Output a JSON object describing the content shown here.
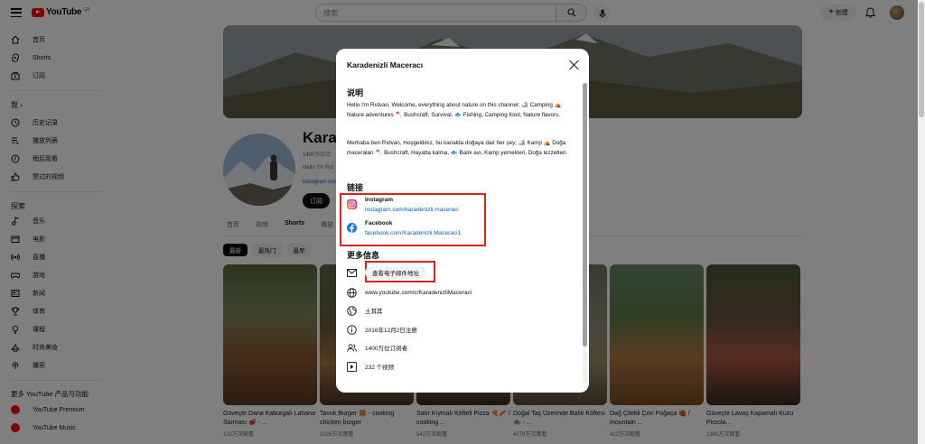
{
  "header": {
    "logo_text": "YouTube",
    "country": "GB",
    "search_placeholder": "搜索",
    "create_label": "创建"
  },
  "sidebar": {
    "main": [
      {
        "label": "首页",
        "icon": "home-icon"
      },
      {
        "label": "Shorts",
        "icon": "shorts-icon"
      },
      {
        "label": "订阅",
        "icon": "subscriptions-icon"
      }
    ],
    "you_header": "我 ›",
    "you": [
      {
        "label": "历史记录",
        "icon": "history-icon"
      },
      {
        "label": "播放列表",
        "icon": "playlist-icon"
      },
      {
        "label": "稍后观看",
        "icon": "watch-later-icon"
      },
      {
        "label": "赞过的视频",
        "icon": "like-icon"
      }
    ],
    "explore_header": "探索",
    "explore": [
      {
        "label": "音乐",
        "icon": "music-icon"
      },
      {
        "label": "电影",
        "icon": "movie-icon"
      },
      {
        "label": "直播",
        "icon": "live-icon"
      },
      {
        "label": "游戏",
        "icon": "gaming-icon"
      },
      {
        "label": "新闻",
        "icon": "news-icon"
      },
      {
        "label": "体育",
        "icon": "trophy-icon"
      },
      {
        "label": "课程",
        "icon": "course-icon"
      },
      {
        "label": "时尚美妆",
        "icon": "fashion-icon"
      },
      {
        "label": "播客",
        "icon": "podcast-icon"
      }
    ],
    "more_header": "更多 YouTube 产品与功能",
    "more": [
      {
        "label": "YouTube Premium"
      },
      {
        "label": "YouTube Music"
      }
    ]
  },
  "channel": {
    "title_partial": "Kara",
    "meta_partial": "1400万位订",
    "desc_partial": "Hello I'm Rıd",
    "link_partial": "instagram.com",
    "subscribe_label": "订阅",
    "tabs": [
      "首页",
      "视频",
      "Shorts",
      "播放"
    ],
    "active_tab": 2,
    "chips": [
      "最新",
      "最热门",
      "最早"
    ],
    "active_chip": 0,
    "shorts": [
      {
        "title": "Güveçte Dana Kaburgalı Lahana Sarması 🥩 - ...",
        "views": "102万次观看"
      },
      {
        "title": "Tavuk Burger 🍔 - cooking chicken burger",
        "views": "1026万次观看"
      },
      {
        "title": "Satır Kıymalı Köfteli Pizza 🍕🥓 / cooking ...",
        "views": "542万次观看"
      },
      {
        "title": "Doğal Taş Üzerinde Balık Köftesi 🐟 - ...",
        "views": "4778万次观看"
      },
      {
        "title": "Dağ Çilekli Çıtır Poğaça 🍓 / mountain ...",
        "views": "422万次观看"
      },
      {
        "title": "Güveçte Lavaş Kapamalı Kuzu Pirzola...",
        "views": "1380万次观看"
      }
    ]
  },
  "dialog": {
    "title": "Karadenizli Maceracı",
    "description_header": "说明",
    "description_en": "Hello I'm Rıdvan, Welcome, everything about nature on this channel; 🏕 Camping ⛺ Nature adventures 🪓 Bushcraft, Survival, 🐟 Fishing, Camping food, Nature flavors.",
    "description_tr": "Merhaba ben Rıdvan, Hoşgeldiniz, bu kanalda doğaya dair her şey; 🏕 Kamp ⛺ Doğa maceraları 🪓 Bushcraft, Hayatta kalma, 🐟 Balık avı, Kamp yemekleri, Doğa lezzetleri.",
    "links_header": "链接",
    "links": [
      {
        "name": "Instagram",
        "url": "instagram.com/karadenizli.maceraci",
        "icon": "instagram-icon",
        "color": "#e1306c"
      },
      {
        "name": "Facebook",
        "url": "facebook.com/Karadenizli.Maceraci1",
        "icon": "facebook-icon",
        "color": "#1877f2"
      }
    ],
    "more_info_header": "更多信息",
    "email_button": "查看电子邮件地址",
    "info": {
      "channel_url": "www.youtube.com/c/KaradenizliMaceraci",
      "country": "土耳其",
      "joined": "2016年12月2日注册",
      "subscribers": "1400万位订阅者",
      "videos": "232 个视频"
    }
  },
  "colors": {
    "youtube_red": "#ff0000",
    "link_blue": "#065fd4",
    "highlight_red": "#e0201f"
  }
}
